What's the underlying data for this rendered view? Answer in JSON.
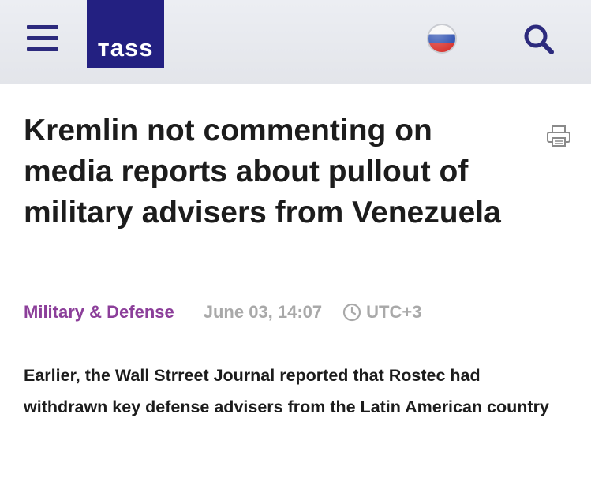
{
  "header": {
    "logo_text": "тass",
    "menu_icon": "hamburger-menu-icon",
    "language_icon": "russian-flag-icon",
    "search_icon": "search-icon",
    "brand_color": "#232081"
  },
  "article": {
    "title": "Kremlin not commenting on media reports about pullout of military advisers from Venezuela",
    "category": "Military & Defense",
    "date": "June 03, 14:07",
    "timezone": "UTC+3",
    "lead": "Earlier, the Wall Strreet Journal reported that Rostec had withdrawn key defense advisers from the Latin American country",
    "print_icon": "printer-icon"
  },
  "colors": {
    "category": "#8c3f9a",
    "meta_gray": "#a9a9a9",
    "header_bg": "#e6e8ed"
  }
}
